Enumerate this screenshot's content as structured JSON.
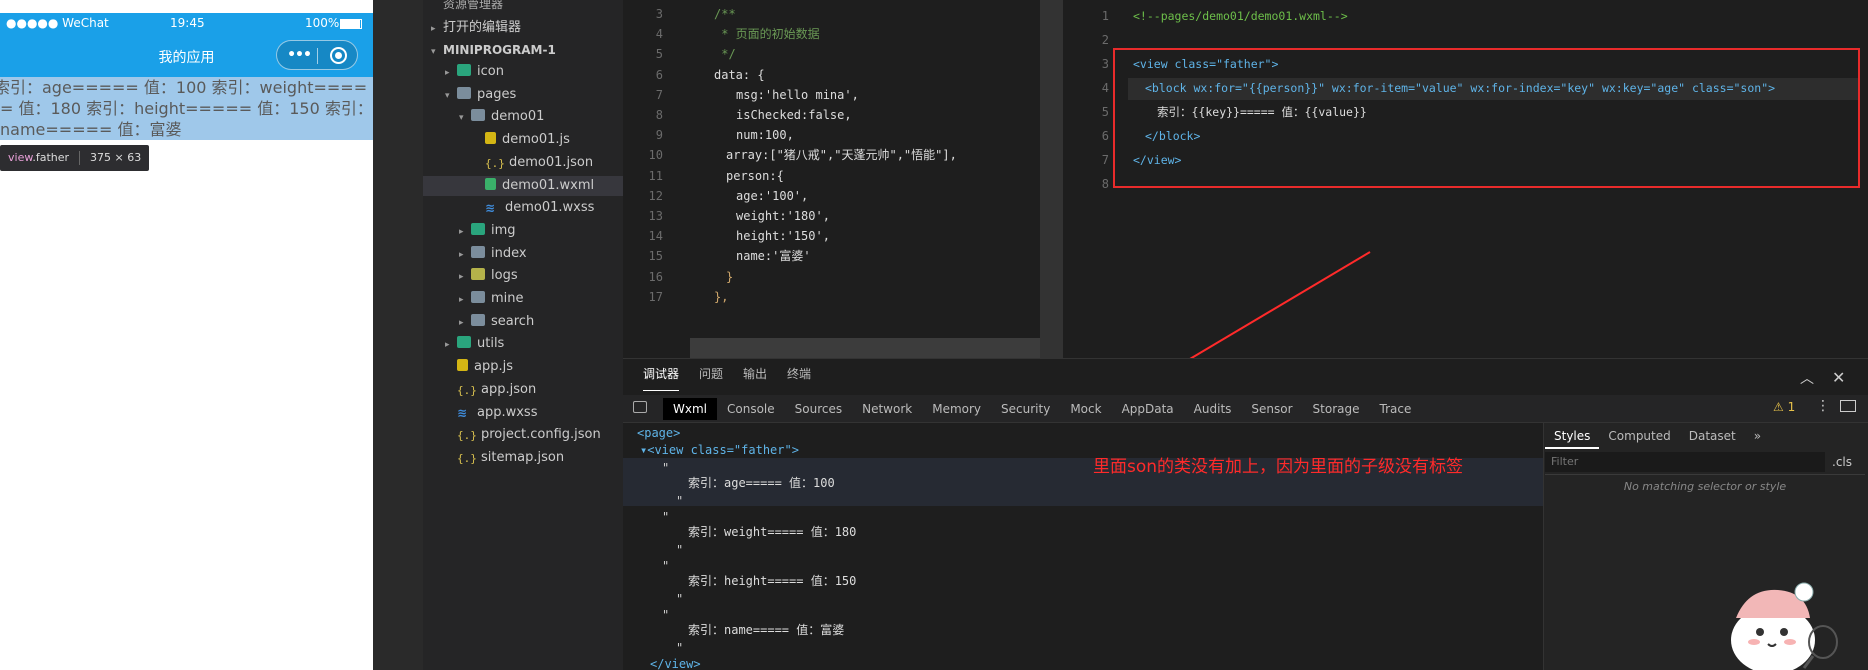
{
  "simulator": {
    "status": {
      "carrier": "●●●●● WeChat",
      "time": "19:45",
      "battery": "100%"
    },
    "nav_title": "我的应用",
    "capsule": {
      "more": "•••"
    },
    "content_text": "索引：age===== 值：100 索引：weight===== 值：180 索引：height===== 值：150 索引：name===== 值：富婆",
    "tooltip": {
      "tag": "view",
      "cls": ".father",
      "size": "375 × 63"
    }
  },
  "file_tree": {
    "header": "资源管理器",
    "open_editors": "打开的编辑器",
    "project": "MINIPROGRAM-1",
    "items": [
      {
        "label": "icon",
        "level": 1,
        "type": "folder-green",
        "caret": "▸"
      },
      {
        "label": "pages",
        "level": 1,
        "type": "folder",
        "caret": "▾"
      },
      {
        "label": "demo01",
        "level": 2,
        "type": "folder",
        "caret": "▾"
      },
      {
        "label": "demo01.js",
        "level": 3,
        "type": "js",
        "caret": ""
      },
      {
        "label": "demo01.json",
        "level": 3,
        "type": "json",
        "caret": ""
      },
      {
        "label": "demo01.wxml",
        "level": 3,
        "type": "wxml",
        "caret": ""
      },
      {
        "label": "demo01.wxss",
        "level": 3,
        "type": "wxss",
        "caret": ""
      },
      {
        "label": "img",
        "level": 2,
        "type": "folder-green",
        "caret": "▸"
      },
      {
        "label": "index",
        "level": 2,
        "type": "folder",
        "caret": "▸"
      },
      {
        "label": "logs",
        "level": 2,
        "type": "folder-yellow",
        "caret": "▸"
      },
      {
        "label": "mine",
        "level": 2,
        "type": "folder",
        "caret": "▸"
      },
      {
        "label": "search",
        "level": 2,
        "type": "folder",
        "caret": "▸"
      },
      {
        "label": "utils",
        "level": 1,
        "type": "folder-green",
        "caret": "▸"
      },
      {
        "label": "app.js",
        "level": 1,
        "type": "js",
        "caret": ""
      },
      {
        "label": "app.json",
        "level": 1,
        "type": "json",
        "caret": ""
      },
      {
        "label": "app.wxss",
        "level": 1,
        "type": "wxss",
        "caret": ""
      },
      {
        "label": "project.config.json",
        "level": 1,
        "type": "json",
        "caret": ""
      },
      {
        "label": "sitemap.json",
        "level": 1,
        "type": "json",
        "caret": ""
      }
    ]
  },
  "editor_js": {
    "lines": [
      {
        "n": "3",
        "text": "/**"
      },
      {
        "n": "4",
        "text": " * 页面的初始数据"
      },
      {
        "n": "5",
        "text": " */"
      },
      {
        "n": "6",
        "text": "data: {"
      },
      {
        "n": "7",
        "text": "msg:'hello mina',"
      },
      {
        "n": "8",
        "text": "isChecked:false,"
      },
      {
        "n": "9",
        "text": "num:100,"
      },
      {
        "n": "10",
        "text": "array:[\"猪八戒\",\"天蓬元帅\",\"悟能\"],"
      },
      {
        "n": "11",
        "text": "person:{"
      },
      {
        "n": "12",
        "text": "age:'100',"
      },
      {
        "n": "13",
        "text": "weight:'180',"
      },
      {
        "n": "14",
        "text": "height:'150',"
      },
      {
        "n": "15",
        "text": "name:'富婆'"
      },
      {
        "n": "16",
        "text": "}"
      },
      {
        "n": "17",
        "text": "},"
      }
    ]
  },
  "editor_wxml": {
    "lines": [
      {
        "n": "1",
        "text": "<!--pages/demo01/demo01.wxml-->"
      },
      {
        "n": "2",
        "text": ""
      },
      {
        "n": "3",
        "text": "<view class=\"father\">"
      },
      {
        "n": "4",
        "text": "<block wx:for=\"{{person}}\" wx:for-item=\"value\" wx:for-index=\"key\" wx:key=\"age\" class=\"son\">"
      },
      {
        "n": "5",
        "text": "索引：{{key}}===== 值：{{value}}"
      },
      {
        "n": "6",
        "text": "</block>"
      },
      {
        "n": "7",
        "text": "</view>"
      },
      {
        "n": "8",
        "text": ""
      }
    ]
  },
  "devtools": {
    "top_tabs": [
      "调试器",
      "问题",
      "输出",
      "终端"
    ],
    "tabs": [
      "Wxml",
      "Console",
      "Sources",
      "Network",
      "Memory",
      "Security",
      "Mock",
      "AppData",
      "Audits",
      "Sensor",
      "Storage",
      "Trace"
    ],
    "warn_count": "1",
    "dom": {
      "page": "<page>",
      "view_open": "▾<view class=\"father\">",
      "quote": "\"",
      "items": [
        "索引：age===== 值：100",
        "索引：weight===== 值：180",
        "索引：height===== 值：150",
        "索引：name===== 值：富婆"
      ],
      "view_close": "</view>"
    },
    "styles_tabs": [
      "Styles",
      "Computed",
      "Dataset",
      "»"
    ],
    "filter_placeholder": "Filter",
    "cls": ".cls",
    "no_match": "No matching selector or style"
  },
  "annotation": "里面son的类没有加上，因为里面的子级没有标签",
  "colors": {
    "accent_blue": "#1aa0e8",
    "selection_blue": "#9fc8ea",
    "annotation_red": "#ff2a2a"
  }
}
